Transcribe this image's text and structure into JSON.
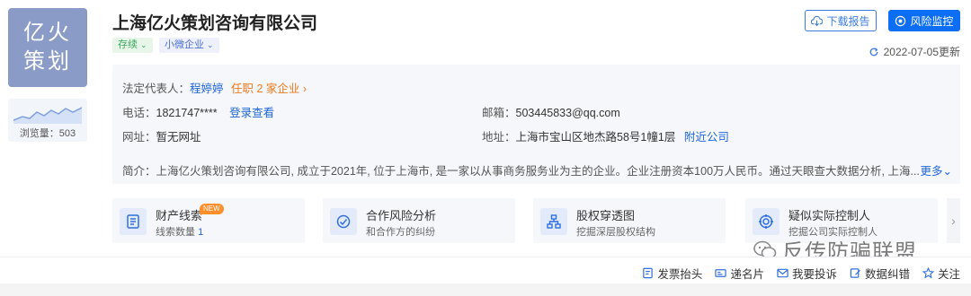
{
  "logo": {
    "line1": "亿火",
    "line2": "策划"
  },
  "views": {
    "label": "浏览量：503"
  },
  "company": {
    "name": "上海亿火策划咨询有限公司",
    "status_tag": "存续",
    "scale_tag": "小微企业"
  },
  "header_buttons": {
    "download": "下载报告",
    "monitor": "风险监控"
  },
  "update_text": "2022-07-05更新",
  "info": {
    "legal_rep_label": "法定代表人：",
    "legal_rep_name": "程婷婷",
    "legal_rep_extra": "任职 2 家企业 ›",
    "phone_label": "电话：",
    "phone_value": "1821747****",
    "phone_link": "登录查看",
    "email_label": "邮箱：",
    "email_value": "503445833@qq.com",
    "website_label": "网址：",
    "website_value": "暂无网址",
    "address_label": "地址：",
    "address_value": "上海市宝山区地杰路58号1幢1层",
    "address_link": "附近公司",
    "intro_label": "简介：",
    "intro_text": "上海亿火策划咨询有限公司, 成立于2021年, 位于上海市, 是一家以从事商务服务业为主的企业。企业注册资本100万人民币。通过天眼查大数据分析, 上海...",
    "more_link": "更多⌄"
  },
  "cards": [
    {
      "title": "财产线索",
      "badge": "NEW",
      "sub_prefix": "线索数量 ",
      "sub_value": "1"
    },
    {
      "title": "合作风险分析",
      "sub_prefix": "和合作方的纠纷",
      "sub_value": ""
    },
    {
      "title": "股权穿透图",
      "sub_prefix": "挖掘深层股权结构",
      "sub_value": ""
    },
    {
      "title": "疑似实际控制人",
      "sub_prefix": "挖掘公司实际控制人",
      "sub_value": ""
    }
  ],
  "watermark": "反传防骗联盟",
  "bottom_actions": [
    "发票抬头",
    "递名片",
    "我要投诉",
    "数据纠错",
    "关注"
  ],
  "colors": {
    "primary": "#0b6ef4",
    "link": "#1f66d8",
    "logo_bg": "#8a9bc7",
    "orange": "#f07a1a"
  }
}
